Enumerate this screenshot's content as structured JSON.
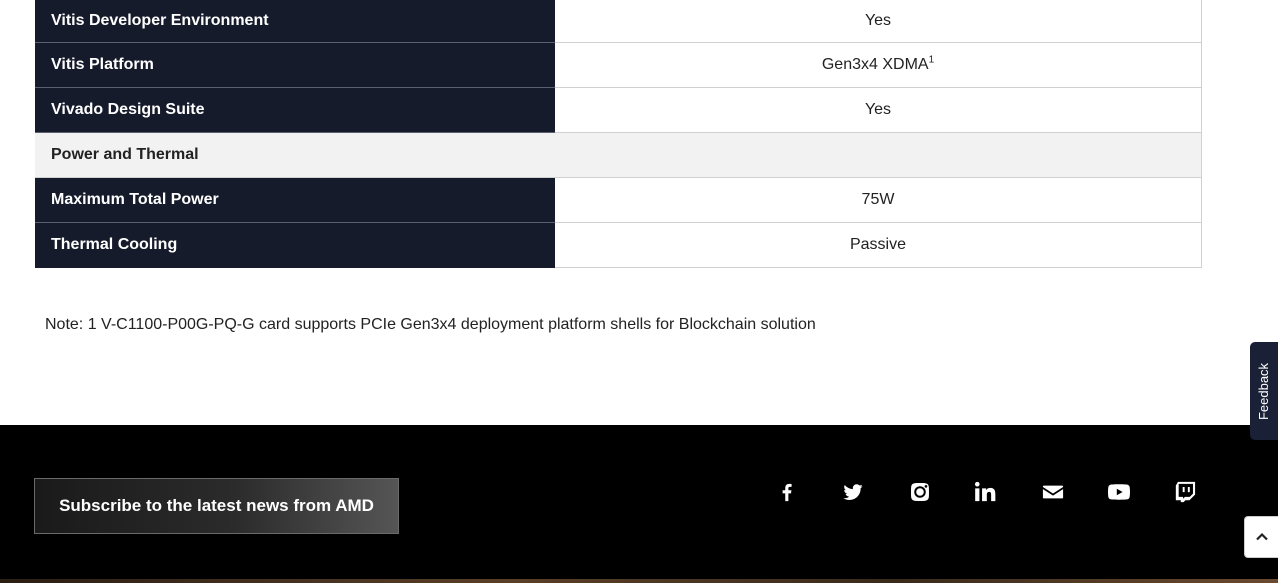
{
  "specs": {
    "rows": [
      {
        "label": "Vitis Developer Environment",
        "value": "Yes"
      },
      {
        "label": "Vitis Platform",
        "value": "Gen3x4 XDMA",
        "sup": "1"
      },
      {
        "label": "Vivado Design Suite",
        "value": "Yes"
      },
      {
        "section": "Power and Thermal"
      },
      {
        "label": "Maximum Total Power",
        "value": "75W"
      },
      {
        "label": "Thermal Cooling",
        "value": "Passive"
      }
    ]
  },
  "note": "Note: 1 V-C1100-P00G-PQ-G card supports PCIe Gen3x4 deployment platform shells for Blockchain solution",
  "footer": {
    "subscribe_label": "Subscribe to the latest news from AMD",
    "social": [
      "facebook-icon",
      "twitter-icon",
      "instagram-icon",
      "linkedin-icon",
      "email-icon",
      "youtube-icon",
      "twitch-icon"
    ]
  },
  "feedback_label": "Feedback"
}
